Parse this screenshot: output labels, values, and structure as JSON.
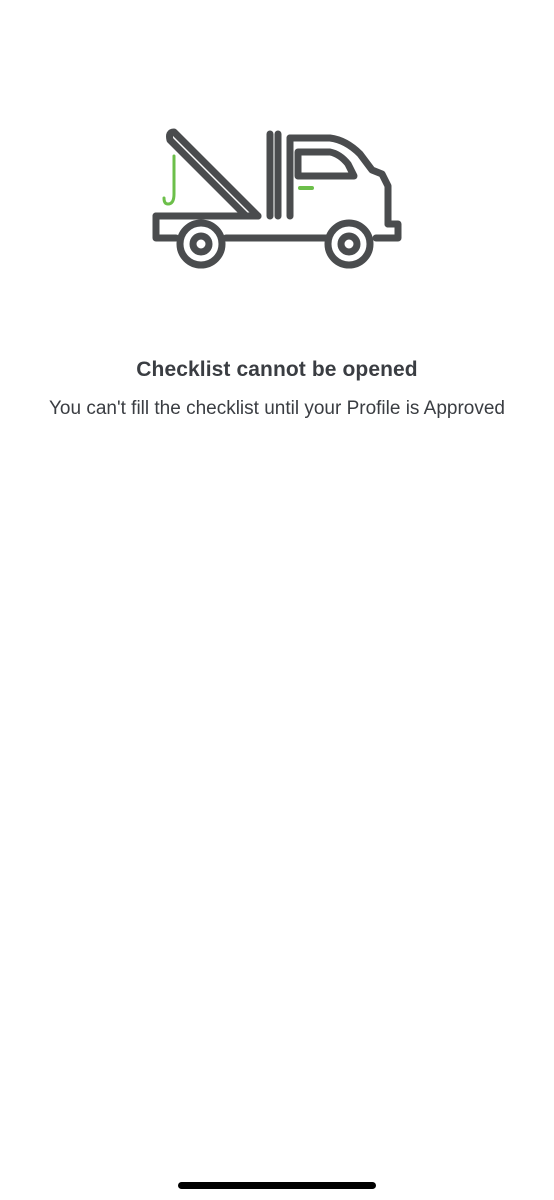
{
  "empty_state": {
    "illustration": "tow-truck-icon",
    "title": "Checklist cannot be opened",
    "message": "You can't fill the checklist until your Profile is Approved"
  },
  "colors": {
    "background": "#ffffff",
    "text": "#3a3d42",
    "truck_outline": "#4a4c4e",
    "accent": "#6cbf4a"
  }
}
